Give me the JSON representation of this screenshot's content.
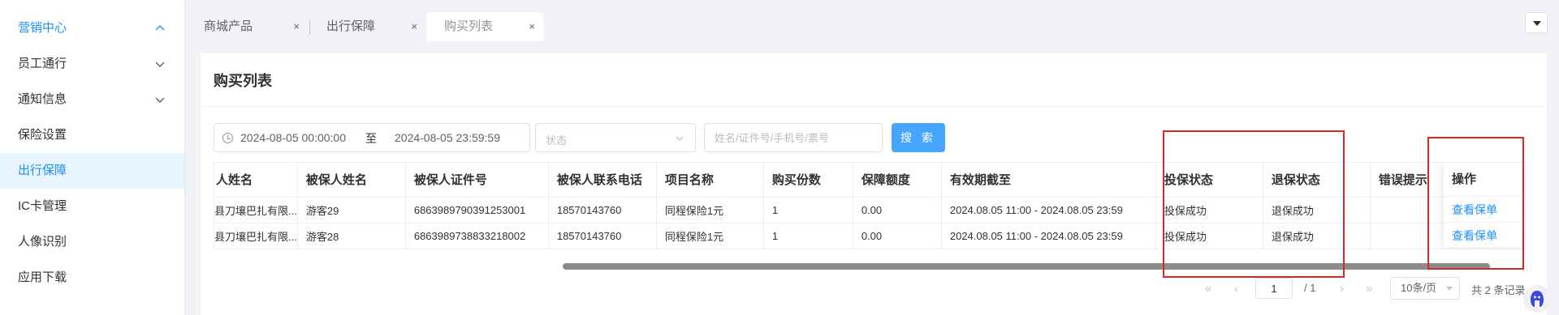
{
  "sidebar": {
    "items": [
      {
        "label": "营销中心",
        "state": "open"
      },
      {
        "label": "员工通行",
        "state": "collapsed"
      },
      {
        "label": "通知信息",
        "state": "collapsed"
      },
      {
        "label": "保险设置"
      },
      {
        "label": "出行保障",
        "state": "active"
      },
      {
        "label": "IC卡管理"
      },
      {
        "label": "人像识别"
      },
      {
        "label": "应用下载"
      }
    ]
  },
  "tabs": [
    {
      "label": "商城产品",
      "close": "×"
    },
    {
      "label": "出行保障",
      "close": "×"
    },
    {
      "label": "购买列表",
      "close": "×",
      "active": true
    }
  ],
  "page": {
    "title": "购买列表"
  },
  "filters": {
    "date_start": "2024-08-05 00:00:00",
    "date_sep": "至",
    "date_end": "2024-08-05 23:59:59",
    "status_placeholder": "状态",
    "keyword_placeholder": "姓名/证件号/手机号/票号",
    "search_label": "搜 索"
  },
  "table": {
    "columns": [
      "人姓名",
      "被保人姓名",
      "被保人证件号",
      "被保人联系电话",
      "项目名称",
      "购买份数",
      "保障额度",
      "有效期截至",
      "投保状态",
      "退保状态",
      "错误提示"
    ],
    "rows": [
      [
        "县刀壤巴扎有限...",
        "游客29",
        "6863989790391253001",
        "18570143760",
        "同程保险1元",
        "1",
        "0.00",
        "2024.08.05 11:00 - 2024.08.05 23:59",
        "投保成功",
        "退保成功",
        ""
      ],
      [
        "县刀壤巴扎有限...",
        "游客28",
        "6863989738833218002",
        "18570143760",
        "同程保险1元",
        "1",
        "0.00",
        "2024.08.05 11:00 - 2024.08.05 23:59",
        "投保成功",
        "退保成功",
        ""
      ]
    ],
    "action_header": "操作",
    "action_label": "查看保单"
  },
  "pagination": {
    "first": "«",
    "prev": "‹",
    "current_page": "1",
    "total_pages": "/ 1",
    "next": "›",
    "last": "»",
    "page_size": "10条/页",
    "total": "共 2 条记录"
  },
  "colors": {
    "accent": "#1890ff",
    "button": "#46a6ff",
    "highlight": "#e02424"
  }
}
